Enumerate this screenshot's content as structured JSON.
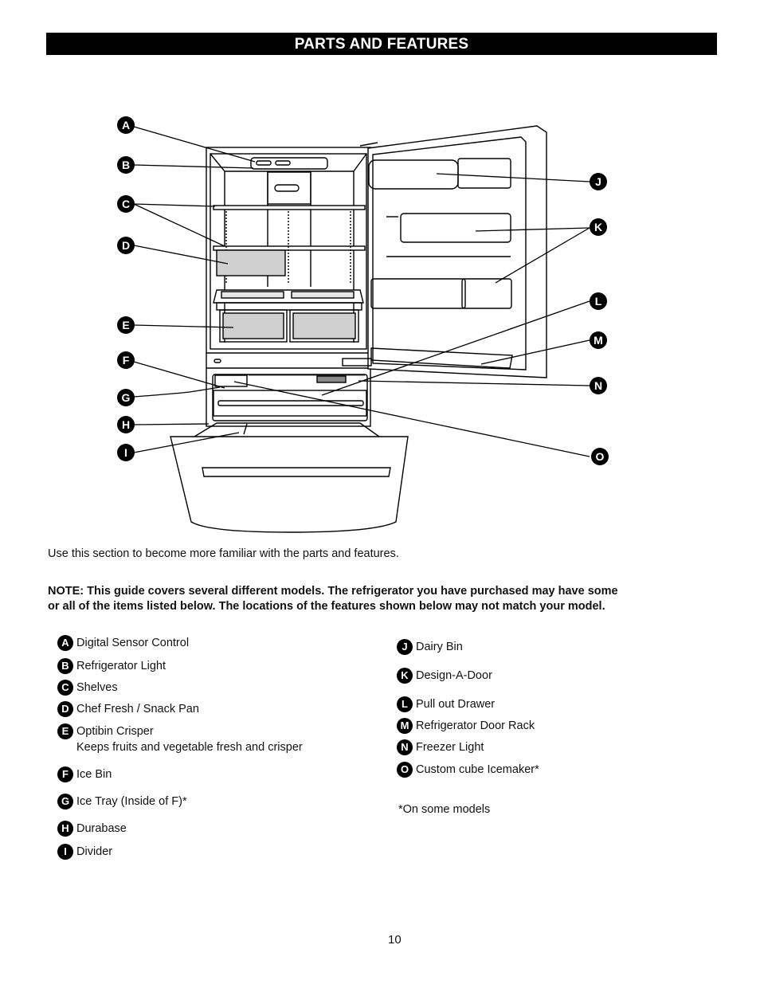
{
  "header": {
    "title": "PARTS AND FEATURES"
  },
  "diagram": {
    "callouts": [
      "A",
      "B",
      "C",
      "D",
      "E",
      "F",
      "G",
      "H",
      "I",
      "J",
      "K",
      "L",
      "M",
      "N",
      "O"
    ]
  },
  "intro_text": "Use this section to become more familiar with the parts and features.",
  "note": {
    "line1": "NOTE: This guide covers several different models. The refrigerator you have purchased may have some",
    "line2": "or all of the items listed below. The locations of the features shown below may not match your model."
  },
  "legend_left": [
    {
      "letter": "A",
      "label": "Digital Sensor Control"
    },
    {
      "letter": "B",
      "label": "Refrigerator Light"
    },
    {
      "letter": "C",
      "label": "Shelves"
    },
    {
      "letter": "D",
      "label": "Chef Fresh / Snack Pan"
    },
    {
      "letter": "E",
      "label": "Optibin Crisper",
      "sub": "Keeps fruits and vegetable fresh and crisper"
    },
    {
      "letter": "F",
      "label": "Ice Bin"
    },
    {
      "letter": "G",
      "label": "Ice Tray (Inside of F)*"
    },
    {
      "letter": "H",
      "label": "Durabase"
    },
    {
      "letter": "I",
      "label": "Divider"
    }
  ],
  "legend_right": [
    {
      "letter": "J",
      "label": "Dairy Bin"
    },
    {
      "letter": "K",
      "label": "Design-A-Door"
    },
    {
      "letter": "L",
      "label": "Pull out Drawer"
    },
    {
      "letter": "M",
      "label": "Refrigerator Door Rack"
    },
    {
      "letter": "N",
      "label": "Freezer Light"
    },
    {
      "letter": "O",
      "label": "Custom cube Icemaker*"
    }
  ],
  "footnote": "*On some models",
  "page_number": "10"
}
